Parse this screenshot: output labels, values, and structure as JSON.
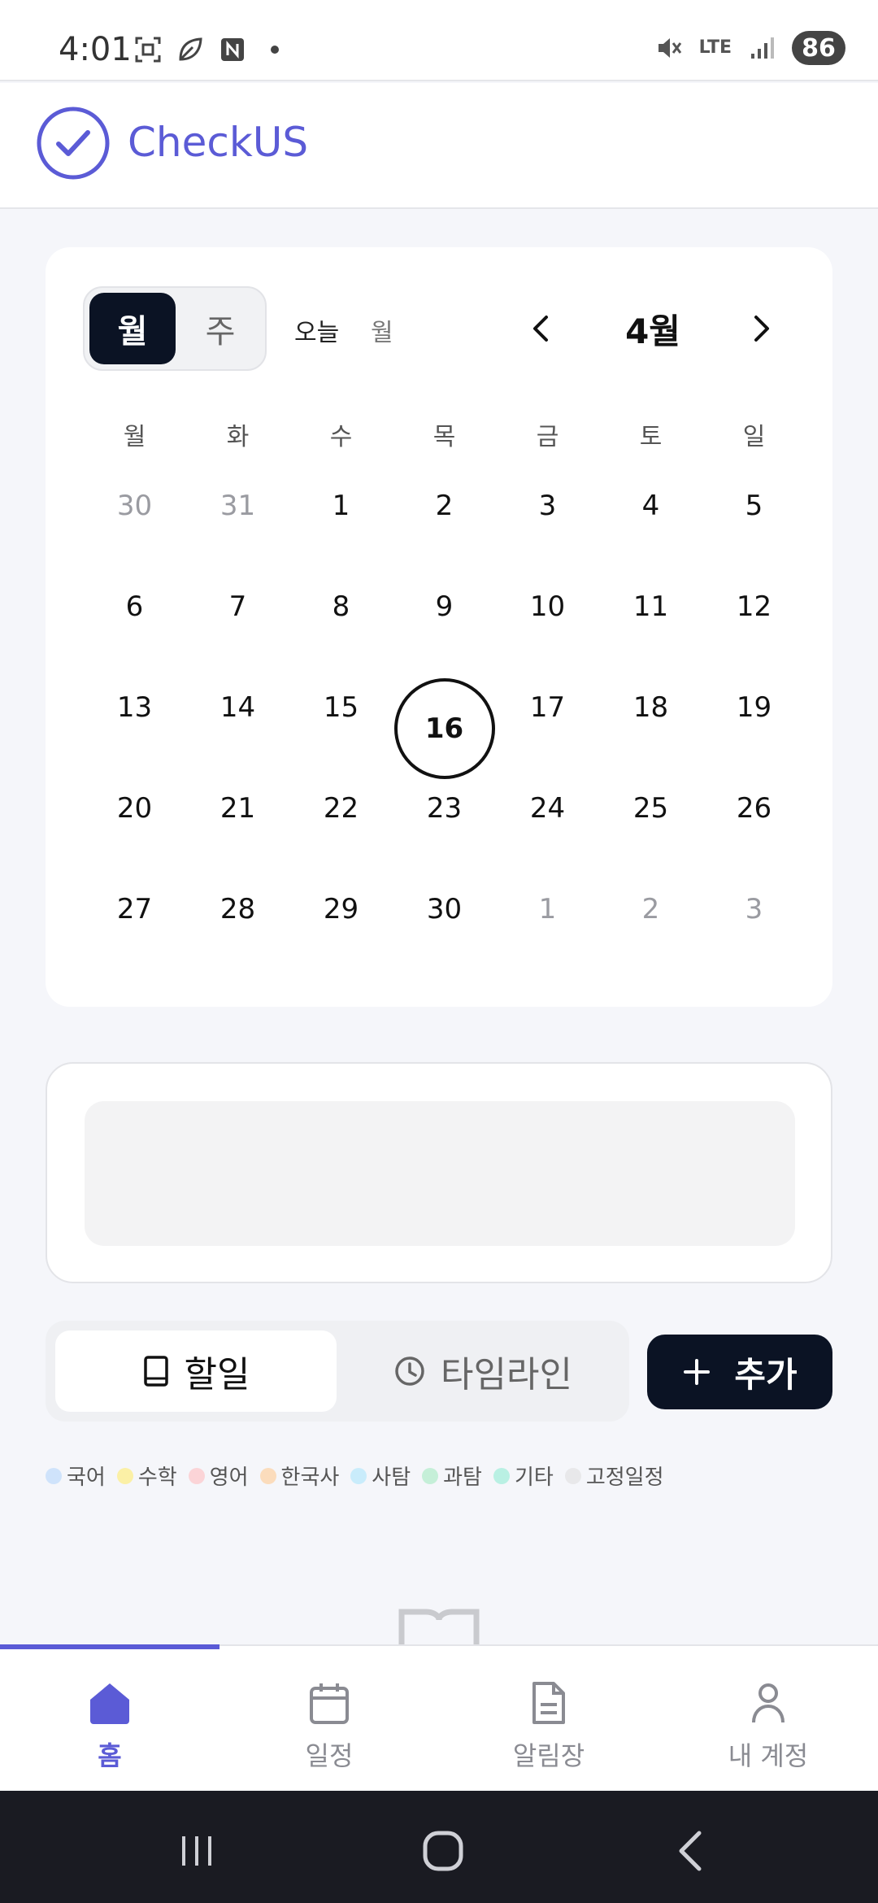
{
  "status_bar": {
    "time": "4:01",
    "network": "LTE",
    "battery": "86"
  },
  "app": {
    "name": "CheckUS",
    "brand_color": "#5b5bd6"
  },
  "calendar": {
    "view_month": "월",
    "view_week": "주",
    "today_label": "오늘",
    "today_sub": "월",
    "month_label": "4월",
    "weekdays": [
      "월",
      "화",
      "수",
      "목",
      "금",
      "토",
      "일"
    ],
    "days": [
      {
        "d": "30",
        "dim": true
      },
      {
        "d": "31",
        "dim": true
      },
      {
        "d": "1"
      },
      {
        "d": "2"
      },
      {
        "d": "3"
      },
      {
        "d": "4"
      },
      {
        "d": "5"
      },
      {
        "d": "6"
      },
      {
        "d": "7"
      },
      {
        "d": "8"
      },
      {
        "d": "9"
      },
      {
        "d": "10"
      },
      {
        "d": "11"
      },
      {
        "d": "12"
      },
      {
        "d": "13"
      },
      {
        "d": "14"
      },
      {
        "d": "15"
      },
      {
        "d": "16",
        "today": true
      },
      {
        "d": "17"
      },
      {
        "d": "18"
      },
      {
        "d": "19"
      },
      {
        "d": "20"
      },
      {
        "d": "21"
      },
      {
        "d": "22"
      },
      {
        "d": "23"
      },
      {
        "d": "24"
      },
      {
        "d": "25"
      },
      {
        "d": "26"
      },
      {
        "d": "27"
      },
      {
        "d": "28"
      },
      {
        "d": "29"
      },
      {
        "d": "30"
      },
      {
        "d": "1",
        "dim": true
      },
      {
        "d": "2",
        "dim": true
      },
      {
        "d": "3",
        "dim": true
      }
    ]
  },
  "tabs": {
    "todo": "할일",
    "timeline": "타임라인",
    "add": "추가"
  },
  "legend": [
    {
      "label": "국어",
      "color": "#cfe3fb"
    },
    {
      "label": "수학",
      "color": "#fbf0a6"
    },
    {
      "label": "영어",
      "color": "#fbd4d7"
    },
    {
      "label": "한국사",
      "color": "#fbdcbc"
    },
    {
      "label": "사탐",
      "color": "#c9ecfb"
    },
    {
      "label": "과탐",
      "color": "#c5efd8"
    },
    {
      "label": "기타",
      "color": "#b9f0e3"
    },
    {
      "label": "고정일정",
      "color": "#e8e8ea"
    }
  ],
  "bottom_nav": {
    "home": "홈",
    "schedule": "일정",
    "notice": "알림장",
    "account": "내 계정"
  }
}
